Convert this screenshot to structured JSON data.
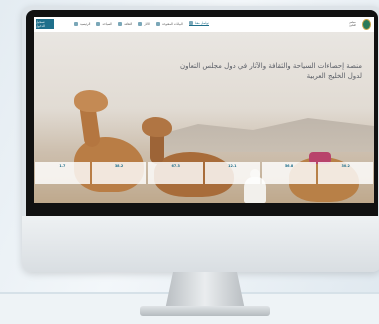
{
  "navbar": {
    "login_label": "تسجيل الدخول",
    "items": [
      {
        "label": "الرئيسية"
      },
      {
        "label": "السياحة"
      },
      {
        "label": "الثقافة"
      },
      {
        "label": "الآثار"
      },
      {
        "label": "البيانات المفتوحة"
      },
      {
        "label": "تواصل معنا"
      }
    ],
    "logo_text": "مجلس التعاون"
  },
  "hero": {
    "title_line1": "منصة إحصاءات السياحة والثقافة والآثار في دول مجلس التعاون",
    "title_line2": "لدول الخليج العربية"
  },
  "stats": [
    {
      "value": "1.7",
      "label": "",
      "sub": ""
    },
    {
      "value": "38.2",
      "label": "",
      "sub": ""
    },
    {
      "value": "67.3",
      "label": "",
      "sub": ""
    },
    {
      "value": "12.1",
      "label": "",
      "sub": ""
    },
    {
      "value": "56.8",
      "label": "",
      "sub": ""
    },
    {
      "value": "30.2",
      "label": "",
      "sub": ""
    }
  ],
  "colors": {
    "accent": "#1f6f8b",
    "brand_green": "#2a7a5a"
  }
}
